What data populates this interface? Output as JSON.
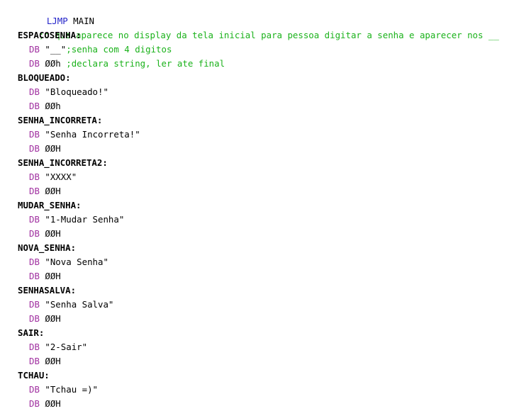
{
  "code": {
    "jump_keyword": "LJMP",
    "jump_target": "MAIN",
    "header_comment": ";o que aparece no display da tela inicial para pessoa digitar a senha e aparecer nos __",
    "blocks": [
      {
        "label": "ESPACOSENHA:",
        "lines": [
          {
            "op": "DB",
            "operand": "\"__\"",
            "comment": ";senha com 4 digitos"
          },
          {
            "op": "DB",
            "operand": "ØØh",
            "comment": ";declara string, ler ate final"
          }
        ]
      },
      {
        "label": "BLOQUEADO:",
        "lines": [
          {
            "op": "DB",
            "operand": "\"Bloqueado!\"",
            "comment": ""
          },
          {
            "op": "DB",
            "operand": "ØØh",
            "comment": ""
          }
        ]
      },
      {
        "label": "SENHA_INCORRETA:",
        "lines": [
          {
            "op": "DB",
            "operand": "\"Senha Incorreta!\"",
            "comment": ""
          },
          {
            "op": "DB",
            "operand": "ØØH",
            "comment": ""
          }
        ]
      },
      {
        "label": "SENHA_INCORRETA2:",
        "lines": [
          {
            "op": "DB",
            "operand": "\"XXXX\"",
            "comment": ""
          },
          {
            "op": "DB",
            "operand": "ØØH",
            "comment": ""
          }
        ]
      },
      {
        "label": "MUDAR_SENHA:",
        "lines": [
          {
            "op": "DB",
            "operand": "\"1-Mudar Senha\"",
            "comment": ""
          },
          {
            "op": "DB",
            "operand": "ØØH",
            "comment": ""
          }
        ]
      },
      {
        "label": "NOVA_SENHA:",
        "lines": [
          {
            "op": "DB",
            "operand": "\"Nova Senha\"",
            "comment": ""
          },
          {
            "op": "DB",
            "operand": "ØØH",
            "comment": ""
          }
        ]
      },
      {
        "label": "SENHASALVA:",
        "lines": [
          {
            "op": "DB",
            "operand": "\"Senha Salva\"",
            "comment": ""
          },
          {
            "op": "DB",
            "operand": "ØØH",
            "comment": ""
          }
        ]
      },
      {
        "label": "SAIR:",
        "lines": [
          {
            "op": "DB",
            "operand": "\"2-Sair\"",
            "comment": ""
          },
          {
            "op": "DB",
            "operand": "ØØH",
            "comment": ""
          }
        ]
      },
      {
        "label": "TCHAU:",
        "lines": [
          {
            "op": "DB",
            "operand": "\"Tchau =)\"",
            "comment": ""
          },
          {
            "op": "DB",
            "operand": "ØØH",
            "comment": ""
          }
        ]
      }
    ]
  },
  "colors": {
    "jump_keyword": "#1f1fc8",
    "directive": "#a030a0",
    "comment": "#1bb21b",
    "label": "#000000",
    "background": "#ffffff"
  }
}
